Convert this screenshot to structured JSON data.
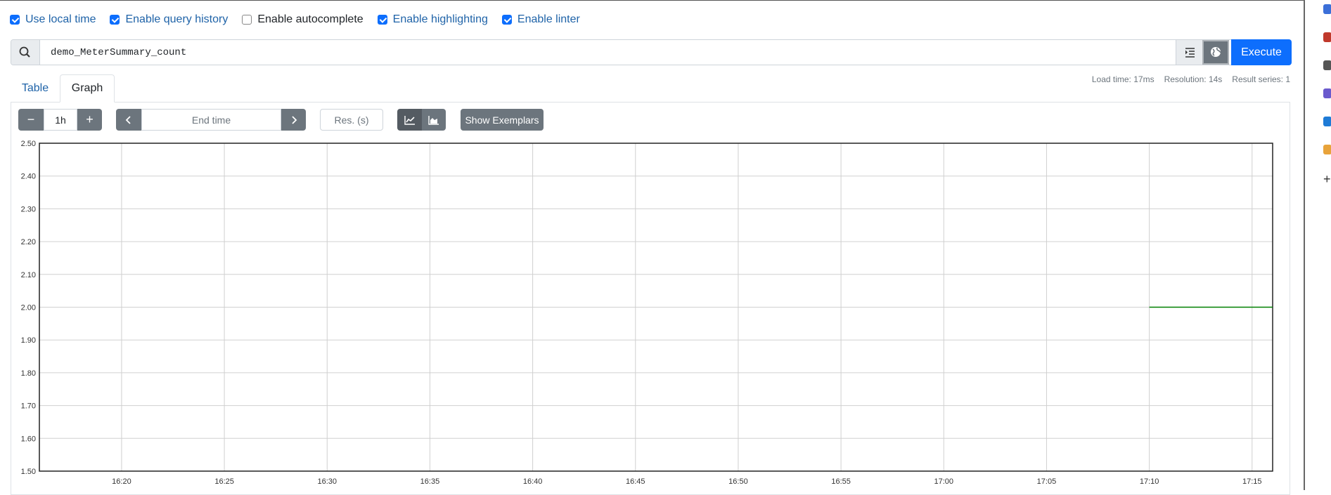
{
  "options": [
    {
      "label": "Use local time",
      "checked": true
    },
    {
      "label": "Enable query history",
      "checked": true
    },
    {
      "label": "Enable autocomplete",
      "checked": false
    },
    {
      "label": "Enable highlighting",
      "checked": true
    },
    {
      "label": "Enable linter",
      "checked": true
    }
  ],
  "query": {
    "value": "demo_MeterSummary_count",
    "execute_label": "Execute"
  },
  "tabs": [
    {
      "label": "Table",
      "active": false
    },
    {
      "label": "Graph",
      "active": true
    }
  ],
  "stats": {
    "load_time": "Load time: 17ms",
    "resolution": "Resolution: 14s",
    "result_series": "Result series: 1"
  },
  "controls": {
    "minus": "−",
    "range": "1h",
    "plus": "+",
    "end_time_placeholder": "End time",
    "res_placeholder": "Res. (s)",
    "show_exemplars": "Show Exemplars"
  },
  "colors": {
    "accent": "#0d6efd",
    "series": "#008000"
  },
  "chart_data": {
    "type": "line",
    "title": "",
    "xlabel": "",
    "ylabel": "",
    "ylim": [
      1.5,
      2.5
    ],
    "yticks": [
      "2.50",
      "2.40",
      "2.30",
      "2.20",
      "2.10",
      "2.00",
      "1.90",
      "1.80",
      "1.70",
      "1.60",
      "1.50"
    ],
    "xlim": [
      "16:16",
      "17:16"
    ],
    "xticks": [
      "16:20",
      "16:25",
      "16:30",
      "16:35",
      "16:40",
      "16:45",
      "16:50",
      "16:55",
      "17:00",
      "17:05",
      "17:10",
      "17:15"
    ],
    "grid": true,
    "series": [
      {
        "x": [
          "17:10",
          "17:16"
        ],
        "values": [
          2.0,
          2.0
        ],
        "color": "#008000"
      }
    ]
  }
}
